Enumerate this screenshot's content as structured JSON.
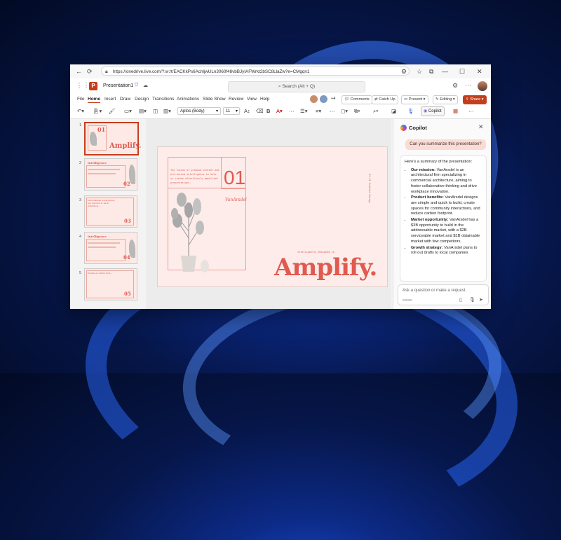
{
  "browser": {
    "url": "https://onedrive.live.com/?:w:/t/EACKkPs6AchljwULn3060f48vbBJyIAFWrkt2bSC8LlaZw?e=CMgqn1"
  },
  "app": {
    "title": "Presentation1",
    "search_placeholder": "Search (Alt + Q)",
    "tabs": [
      "File",
      "Home",
      "Insert",
      "Draw",
      "Design",
      "Transitions",
      "Animations",
      "Slide Show",
      "Review",
      "View",
      "Help"
    ],
    "active_tab": "Home",
    "collab_count": "+4",
    "comments_label": "Comments",
    "catchup_label": "Catch Up",
    "present_label": "Present",
    "editing_label": "Editing",
    "share_label": "Share",
    "font_name": "Aptos (Body)",
    "font_size": "11",
    "copilot_button_label": "Copilot"
  },
  "slides": [
    {
      "number": "1",
      "big": "01",
      "title": "Amplify."
    },
    {
      "number": "2",
      "heading": "Intelligence",
      "big": "02"
    },
    {
      "number": "3",
      "heading": "Personalized experiences are tailored to each individual...",
      "big": "03"
    },
    {
      "number": "4",
      "heading": "Intelligence",
      "big": "04"
    },
    {
      "number": "5",
      "heading": "Enable a culture that...",
      "big": "05"
    }
  ],
  "main_slide": {
    "body_text": "The fusion of premium content and pre-vetted intelligence to help us create effortlessly amplified presentations.",
    "number": "01",
    "brand": "VanArsdel",
    "subtitle": "Intelligently Designed to",
    "title": "Amplify.",
    "side_text": "01    AI Enabled Design"
  },
  "copilot": {
    "title": "Copilot",
    "prompt": "Can you summarize this presentation?",
    "intro": "Here's a summary of the presentation:",
    "bullets": [
      {
        "label": "Our mission:",
        "text": "VanArsdel is an architectural firm specializing in commercial architecture, aiming to foster collaborative thinking and drive workplace innovation."
      },
      {
        "label": "Product benefits:",
        "text": "VanArsdel designs are simple and quick to build, create spaces for community interactions, and reduce carbon footprint."
      },
      {
        "label": "Market opportunity:",
        "text": "VanArsdel has a $3B opportunity to build in the addressable market, with a $2B serviceable market and $1B obtainable market with few competitors."
      },
      {
        "label": "Growth strategy:",
        "text": "VanArsdel plans to roll out drafts to local companies"
      }
    ],
    "input_placeholder": "Ask a question or make a request.",
    "char_count": "0/2000"
  }
}
